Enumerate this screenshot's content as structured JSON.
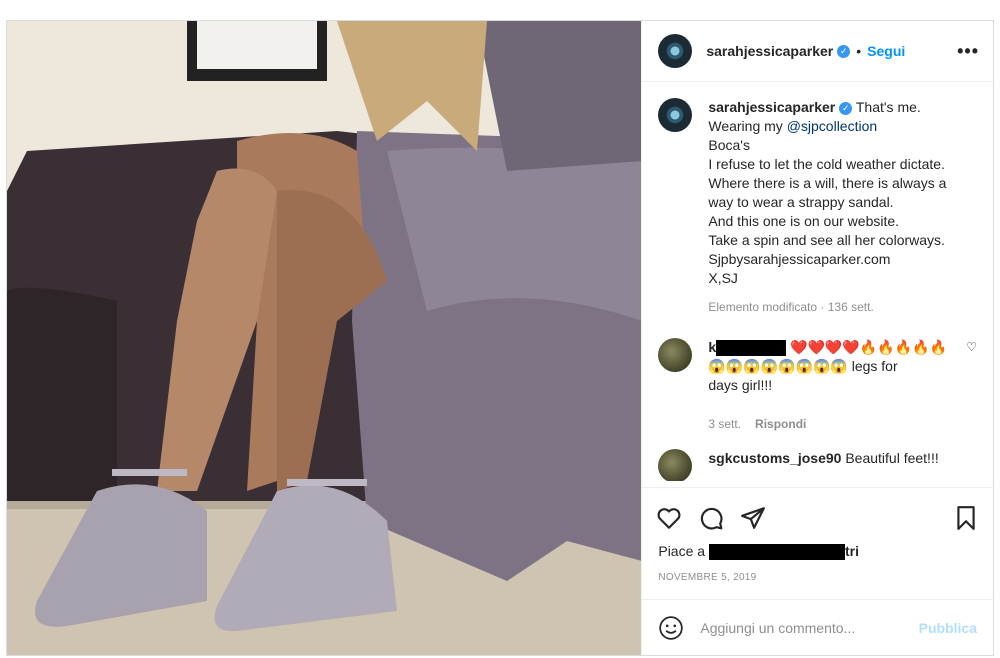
{
  "post": {
    "username": "sarahjessicaparker",
    "follow_label": "Segui",
    "caption": {
      "username": "sarahjessicaparker",
      "lines": [
        "That's me.",
        "Wearing my ",
        "@sjpcollection",
        "Boca's",
        "I refuse to let the cold weather dictate.",
        "Where there is a will, there is always a",
        "way to wear a strappy sandal.",
        "And this one is on our website.",
        "Take a spin and see all her colorways.",
        "Sjpbysarahjessicaparker.com",
        "X,SJ"
      ],
      "meta": "Elemento modificato · 136 sett."
    },
    "comments": [
      {
        "username_prefix": "k",
        "emoji_line1": "❤️❤️❤️❤️🔥🔥🔥🔥🔥",
        "emoji_line2": "😱😱😱😱😱😱😱😱",
        "text_tail": " legs for",
        "text_tail2": "days girl!!!",
        "age": "3 sett.",
        "reply_label": "Rispondi"
      },
      {
        "username": "sgkcustoms_jose90",
        "text": "Beautiful feet!!!"
      }
    ],
    "likes_prefix": "Piace a",
    "likes_suffix": "tri",
    "date": "NOVEMBRE 5, 2019",
    "add_comment_placeholder": "Aggiungi un commento...",
    "publish_label": "Pubblica"
  },
  "icons": {
    "like": "heart-icon",
    "comment": "comment-icon",
    "share": "share-icon",
    "save": "bookmark-icon",
    "more": "more-icon",
    "emoji": "emoji-icon",
    "verified": "verified-badge-icon"
  },
  "colors": {
    "accent": "#0095f6",
    "publish_disabled": "#b2dffc",
    "mention": "#00376b",
    "muted": "#8e8e8e"
  }
}
